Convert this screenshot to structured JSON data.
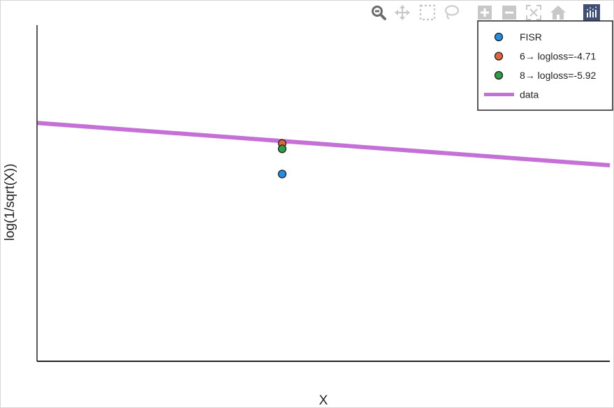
{
  "modebar": {
    "buttons": [
      {
        "name": "zoom-icon",
        "active": true
      },
      {
        "name": "pan-icon",
        "active": false
      },
      {
        "name": "box-select-icon",
        "active": false
      },
      {
        "name": "lasso-select-icon",
        "active": false
      },
      {
        "name": "zoom-in-icon",
        "active": false
      },
      {
        "name": "zoom-out-icon",
        "active": false
      },
      {
        "name": "autoscale-icon",
        "active": false
      },
      {
        "name": "reset-axes-icon",
        "active": false
      },
      {
        "name": "logo-icon",
        "active": false
      }
    ]
  },
  "chart_data": {
    "type": "scatter",
    "xlabel": "X",
    "ylabel": "log(1/sqrt(X))",
    "xlim": [
      0,
      1
    ],
    "ylim": [
      0,
      1
    ],
    "grid": false,
    "legend_position": "top-right",
    "series": [
      {
        "name": "FISR",
        "kind": "marker",
        "color": "#1f8ee8",
        "points": [
          {
            "x": 0.428,
            "y": 0.557
          }
        ]
      },
      {
        "name": "6→ logloss=-4.71",
        "kind": "marker",
        "color": "#e0643c",
        "points": [
          {
            "x": 0.428,
            "y": 0.648
          }
        ]
      },
      {
        "name": "8→ logloss=-5.92",
        "kind": "marker",
        "color": "#2e9e44",
        "points": [
          {
            "x": 0.428,
            "y": 0.632
          }
        ]
      },
      {
        "name": "data",
        "kind": "line",
        "color": "#c470d6",
        "points": [
          {
            "x": 0.0,
            "y": 0.709
          },
          {
            "x": 1.0,
            "y": 0.583
          }
        ]
      }
    ]
  }
}
